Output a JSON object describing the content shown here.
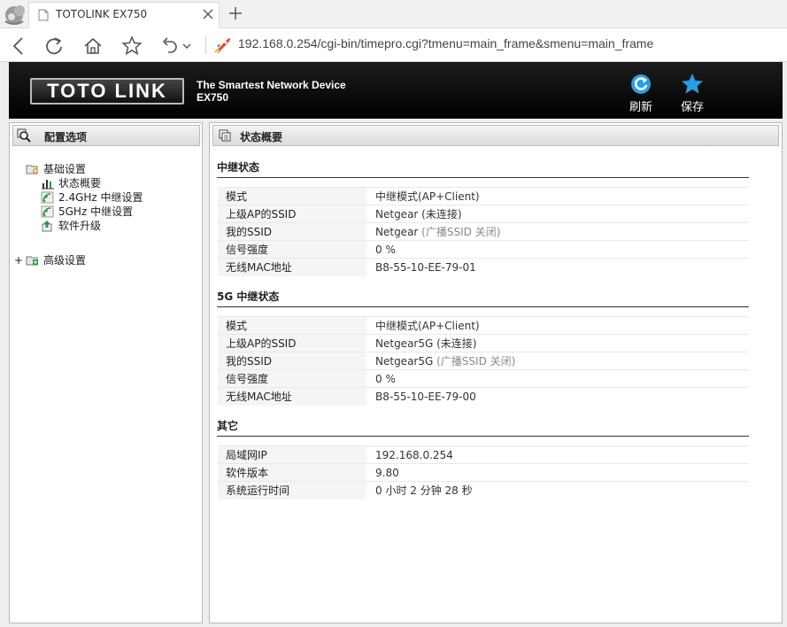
{
  "browser": {
    "tab_title": "TOTOLINK EX750",
    "url": "192.168.0.254/cgi-bin/timepro.cgi?tmenu=main_frame&smenu=main_frame"
  },
  "header": {
    "logo_text": "TOTO LINK",
    "tagline": "The Smartest Network Device",
    "model": "EX750",
    "refresh_label": "刷新",
    "save_label": "保存"
  },
  "sidebar": {
    "title": "配置选项",
    "groups": [
      {
        "label": "基础设置",
        "items": [
          {
            "label": "状态概要"
          },
          {
            "label": "2.4GHz 中继设置"
          },
          {
            "label": "5GHz 中继设置"
          },
          {
            "label": "软件升级"
          }
        ]
      },
      {
        "expander": "+",
        "label": "高级设置"
      }
    ]
  },
  "main": {
    "title": "状态概要",
    "sections": [
      {
        "title": "中继状态",
        "rows": [
          {
            "key": "模式",
            "value": "中继模式(AP+Client)",
            "note": ""
          },
          {
            "key": "上级AP的SSID",
            "value": "Netgear",
            "note": " (未连接)"
          },
          {
            "key": "我的SSID",
            "value": "Netgear",
            "note": " (广播SSID 关闭)"
          },
          {
            "key": "信号强度",
            "value": "0 %",
            "note": ""
          },
          {
            "key": "无线MAC地址",
            "value": "B8-55-10-EE-79-01",
            "note": ""
          }
        ]
      },
      {
        "title": "5G 中继状态",
        "rows": [
          {
            "key": "模式",
            "value": "中继模式(AP+Client)",
            "note": ""
          },
          {
            "key": "上级AP的SSID",
            "value": "Netgear5G",
            "note": " (未连接)"
          },
          {
            "key": "我的SSID",
            "value": "Netgear5G",
            "note": " (广播SSID 关闭)"
          },
          {
            "key": "信号强度",
            "value": "0 %",
            "note": ""
          },
          {
            "key": "无线MAC地址",
            "value": "B8-55-10-EE-79-00",
            "note": ""
          }
        ]
      },
      {
        "title": "其它",
        "rows": [
          {
            "key": "局域网IP",
            "value": "192.168.0.254",
            "note": ""
          },
          {
            "key": "软件版本",
            "value": "9.80",
            "note": ""
          },
          {
            "key": "系统运行时间",
            "value": "0 小时 2 分钟 28 秒",
            "note": ""
          }
        ]
      }
    ]
  },
  "icons": {
    "browser_logo": "uc-browser-squirrel-icon",
    "refresh": "refresh-icon",
    "save": "star-icon"
  },
  "colors": {
    "header_bg": "#000000",
    "accent_blue": "#2a9de8",
    "panel_border": "#b8b8b8"
  }
}
